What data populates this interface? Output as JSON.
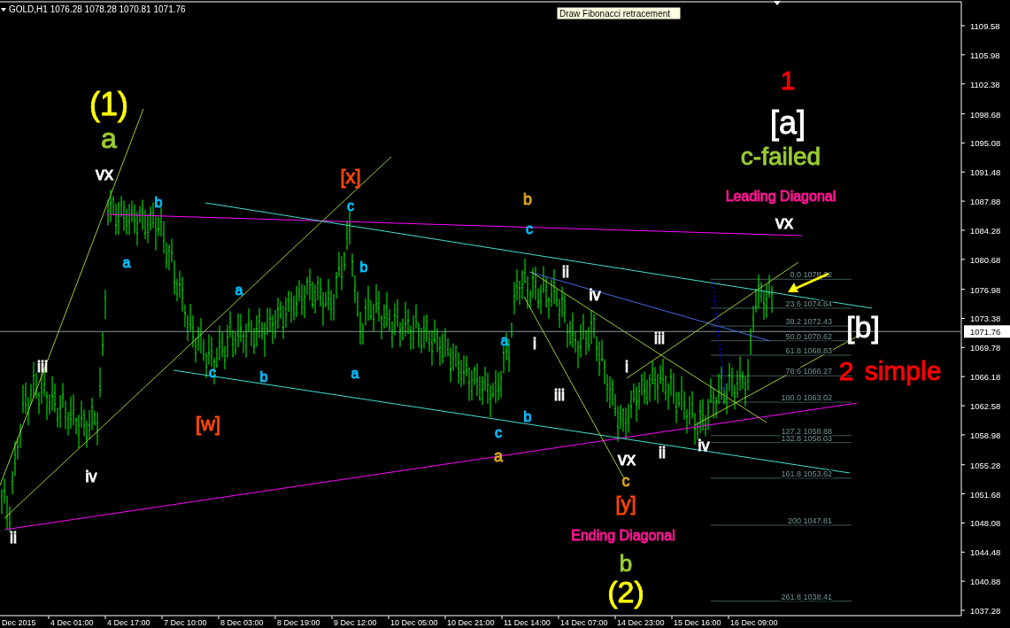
{
  "header": {
    "symbol": "GOLD,H1",
    "quotes": [
      "1076.28",
      "1078.28",
      "1070.81",
      "1071.76"
    ]
  },
  "tooltip": "Draw Fibonacci retracement",
  "price_axis": {
    "ticks": [
      "1109.58",
      "1105.98",
      "1102.38",
      "1098.68",
      "1095.08",
      "1091.48",
      "1087.88",
      "1084.28",
      "1080.68",
      "1076.98",
      "1073.38",
      "1069.78",
      "1066.18",
      "1062.58",
      "1058.98",
      "1055.28",
      "1051.68",
      "1048.08",
      "1044.48",
      "1040.88",
      "1037.28"
    ],
    "current_price": "1071.76"
  },
  "time_axis": [
    "Dec 2015",
    "4 Dec 01:00",
    "4 Dec 17:00",
    "7 Dec 10:00",
    "8 Dec 03:00",
    "8 Dec 19:00",
    "9 Dec 12:00",
    "10 Dec 05:00",
    "10 Dec 21:00",
    "11 Dec 14:00",
    "14 Dec 07:00",
    "14 Dec 23:00",
    "15 Dec 16:00",
    "16 Dec 09:00"
  ],
  "fibonacci": [
    {
      "ratio": "0.0",
      "price": "1078.22"
    },
    {
      "ratio": "23.6",
      "price": "1074.64"
    },
    {
      "ratio": "38.2",
      "price": "1072.43"
    },
    {
      "ratio": "50.0",
      "price": "1070.62"
    },
    {
      "ratio": "61.8",
      "price": "1068.83"
    },
    {
      "ratio": "78.6",
      "price": "1066.27"
    },
    {
      "ratio": "100.0",
      "price": "1063.02"
    },
    {
      "ratio": "127.2",
      "price": "1058.88"
    },
    {
      "ratio": "132.8",
      "price": "1058.03"
    },
    {
      "ratio": "161.8",
      "price": "1053.62"
    },
    {
      "ratio": "200",
      "price": "1047.81"
    },
    {
      "ratio": "261.8",
      "price": "1038.41"
    }
  ],
  "wave_labels": [
    {
      "text": "1",
      "color": "#ff0000"
    },
    {
      "text": "(1)",
      "color": "#ffff00"
    },
    {
      "text": "a",
      "color": "#9acd32"
    },
    {
      "text": "[a]",
      "color": "#ffffff"
    },
    {
      "text": "c-failed",
      "color": "#9acd32"
    },
    {
      "text": "vx",
      "color": "#ffffff"
    },
    {
      "text": "[x]",
      "color": "#ff4500"
    },
    {
      "text": "b",
      "color": "#00bfff"
    },
    {
      "text": "c",
      "color": "#00bfff"
    },
    {
      "text": "b",
      "color": "#daa520"
    },
    {
      "text": "Leading Diagonal",
      "color": "#ff1493"
    },
    {
      "text": "c",
      "color": "#00bfff"
    },
    {
      "text": "vx",
      "color": "#ffffff"
    },
    {
      "text": "a",
      "color": "#00bfff"
    },
    {
      "text": "b",
      "color": "#00bfff"
    },
    {
      "text": "ii",
      "color": "#ffffff"
    },
    {
      "text": "a",
      "color": "#00bfff"
    },
    {
      "text": "iv",
      "color": "#ffffff"
    },
    {
      "text": "a",
      "color": "#00bfff"
    },
    {
      "text": "i",
      "color": "#ffffff"
    },
    {
      "text": "iii",
      "color": "#ffffff"
    },
    {
      "text": "[b]",
      "color": "#ffffff"
    },
    {
      "text": "iii",
      "color": "#ffffff"
    },
    {
      "text": "c",
      "color": "#00bfff"
    },
    {
      "text": "b",
      "color": "#00bfff"
    },
    {
      "text": "a",
      "color": "#00bfff"
    },
    {
      "text": "i",
      "color": "#ffffff"
    },
    {
      "text": "2",
      "color": "#ff0000"
    },
    {
      "text": "simple",
      "color": "#ff0000"
    },
    {
      "text": "iii",
      "color": "#ffffff"
    },
    {
      "text": "[w]",
      "color": "#ff4500"
    },
    {
      "text": "b",
      "color": "#00bfff"
    },
    {
      "text": "c",
      "color": "#00bfff"
    },
    {
      "text": "a",
      "color": "#daa520"
    },
    {
      "text": "vx",
      "color": "#ffffff"
    },
    {
      "text": "ii",
      "color": "#ffffff"
    },
    {
      "text": "iv",
      "color": "#ffffff"
    },
    {
      "text": "iv",
      "color": "#ffffff"
    },
    {
      "text": "c",
      "color": "#daa520"
    },
    {
      "text": "[y]",
      "color": "#ff4500"
    },
    {
      "text": "ii",
      "color": "#ffffff"
    },
    {
      "text": "Ending Diagonal",
      "color": "#ff1493"
    },
    {
      "text": "b",
      "color": "#9acd32"
    },
    {
      "text": "(2)",
      "color": "#ffff00"
    }
  ]
}
